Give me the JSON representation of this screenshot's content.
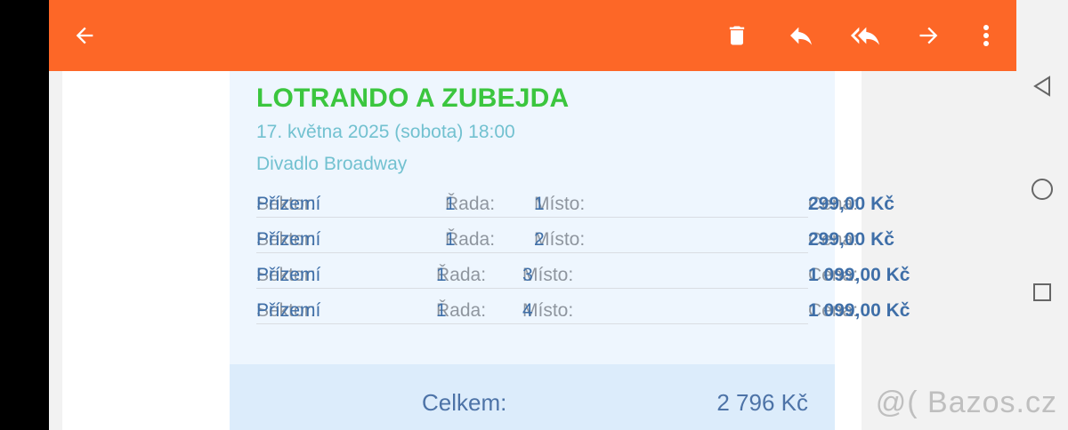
{
  "colors": {
    "appbar": "#fd6727",
    "title": "#3bc63e",
    "meta": "#72c1d0",
    "value": "#3f6fa8",
    "label": "#8f969f"
  },
  "toolbar": {
    "back": "back-arrow-icon",
    "actions": [
      "delete-icon",
      "reply-icon",
      "reply-all-icon",
      "forward-icon",
      "more-vert-icon"
    ]
  },
  "event": {
    "title": "LOTRANDO A ZUBEJDA",
    "date": "17. května 2025 (sobota) 18:00",
    "venue": "Divadlo Broadway"
  },
  "labels": {
    "sector": "Sektor:",
    "row": "Řada:",
    "seat": "Místo:",
    "price": "Cena:"
  },
  "tickets": [
    {
      "sector": "Přízemí",
      "row": "1",
      "seat": "1",
      "price": "299,00 Kč"
    },
    {
      "sector": "Přízemí",
      "row": "1",
      "seat": "2",
      "price": "299,00 Kč"
    },
    {
      "sector": "Přízemí",
      "row": "1",
      "seat": "3",
      "price": "1 099,00 Kč"
    },
    {
      "sector": "Přízemí",
      "row": "1",
      "seat": "4",
      "price": "1 099,00 Kč"
    }
  ],
  "total": {
    "label": "Celkem:",
    "value": "2 796 Kč"
  },
  "navbar": [
    "nav-back-icon",
    "nav-home-icon",
    "nav-recents-icon"
  ],
  "watermark": "@( Bazos.cz"
}
